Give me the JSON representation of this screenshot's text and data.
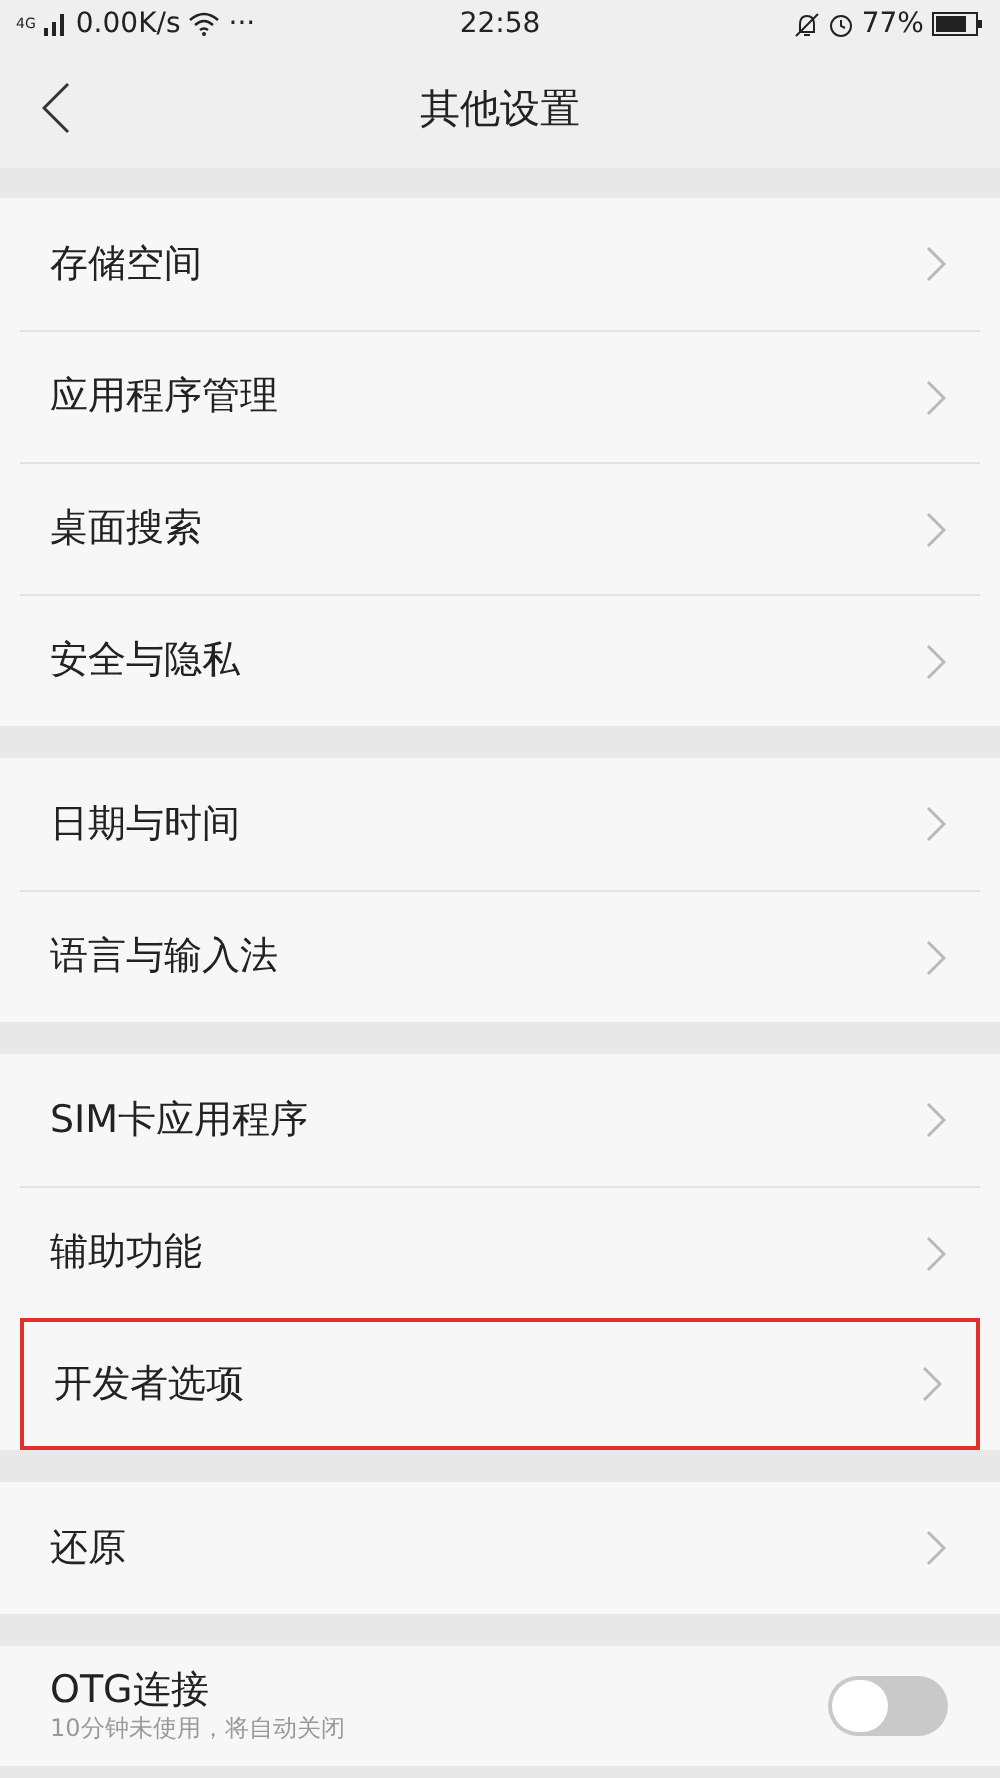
{
  "status_bar": {
    "network": "4G",
    "speed": "0.00K/s",
    "more": "···",
    "time": "22:58",
    "battery": "77%"
  },
  "header": {
    "title": "其他设置"
  },
  "groups": [
    {
      "items": [
        {
          "kind": "link",
          "label": "存储空间",
          "highlighted": false
        },
        {
          "kind": "link",
          "label": "应用程序管理",
          "highlighted": false
        },
        {
          "kind": "link",
          "label": "桌面搜索",
          "highlighted": false
        },
        {
          "kind": "link",
          "label": "安全与隐私",
          "highlighted": false
        }
      ]
    },
    {
      "items": [
        {
          "kind": "link",
          "label": "日期与时间",
          "highlighted": false
        },
        {
          "kind": "link",
          "label": "语言与输入法",
          "highlighted": false
        }
      ]
    },
    {
      "items": [
        {
          "kind": "link",
          "label": "SIM卡应用程序",
          "highlighted": false
        },
        {
          "kind": "link",
          "label": "辅助功能",
          "highlighted": false
        },
        {
          "kind": "link",
          "label": "开发者选项",
          "highlighted": true
        }
      ]
    },
    {
      "items": [
        {
          "kind": "link",
          "label": "还原",
          "highlighted": false
        }
      ]
    },
    {
      "items": [
        {
          "kind": "toggle",
          "label": "OTG连接",
          "subtitle": "10分钟未使用，将自动关闭",
          "on": false
        }
      ]
    }
  ]
}
